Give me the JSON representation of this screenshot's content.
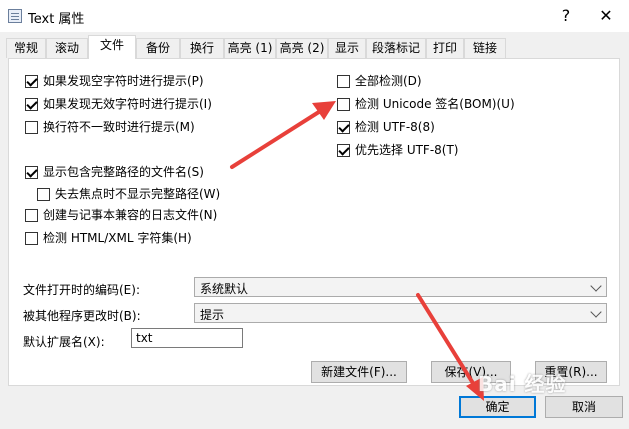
{
  "window": {
    "title": "Text 属性",
    "help_label": "?",
    "close_label": "✕"
  },
  "tabs": [
    "常规",
    "滚动",
    "文件",
    "备份",
    "换行",
    "高亮 (1)",
    "高亮 (2)",
    "显示",
    "段落标记",
    "打印",
    "链接"
  ],
  "active_tab": "文件",
  "left_options": [
    {
      "label": "如果发现空字符时进行提示(P)",
      "checked": true
    },
    {
      "label": "如果发现无效字符时进行提示(I)",
      "checked": true
    },
    {
      "label": "换行符不一致时进行提示(M)",
      "checked": false
    },
    {
      "label": "显示包含完整路径的文件名(S)",
      "checked": true
    },
    {
      "label": "失去焦点时不显示完整路径(W)",
      "checked": false
    },
    {
      "label": "创建与记事本兼容的日志文件(N)",
      "checked": false
    },
    {
      "label": "检测 HTML/XML 字符集(H)",
      "checked": false
    }
  ],
  "right_options": [
    {
      "label": "全部检测(D)",
      "checked": false
    },
    {
      "label": "检测 Unicode 签名(BOM)(U)",
      "checked": false
    },
    {
      "label": "检测 UTF-8(8)",
      "checked": true
    },
    {
      "label": "优先选择 UTF-8(T)",
      "checked": true
    }
  ],
  "fields": {
    "open_encoding_label": "文件打开时的编码(E):",
    "open_encoding_value": "系统默认",
    "external_change_label": "被其他程序更改时(B):",
    "external_change_value": "提示",
    "default_ext_label": "默认扩展名(X):",
    "default_ext_value": "txt"
  },
  "buttons": {
    "new_file": "新建文件(F)...",
    "save": "保存(V)...",
    "reset": "重置(R)...",
    "ok": "确定",
    "cancel": "取消"
  },
  "annotation": {
    "arrow_color": "#e8403a",
    "watermark": "Bai 经验"
  }
}
